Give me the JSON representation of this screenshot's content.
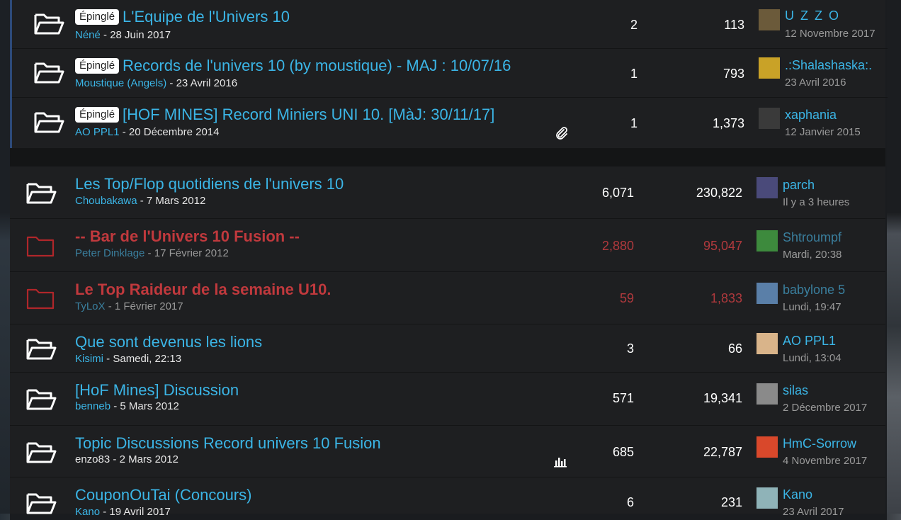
{
  "pinned_badge": "Épinglé",
  "pinned_topics": [
    {
      "title": "L'Equipe de l'Univers 10",
      "author": "Néné",
      "date": "28 Juin 2017",
      "replies": "2",
      "views": "113",
      "last_user": "U Z Z O",
      "last_date": "12 Novembre 2017",
      "avatar_color": "#6b5a3a"
    },
    {
      "title": "Records de l'univers 10 (by moustique) - MAJ : 10/07/16",
      "author": "Moustique (Angels)",
      "date": "23 Avril 2016",
      "replies": "1",
      "views": "793",
      "last_user": ".:Shalashaska:.",
      "last_date": "23 Avril 2016",
      "avatar_color": "#c9a227"
    },
    {
      "title": "[HOF MINES] Record Miniers UNI 10. [MàJ: 30/11/17]",
      "author": "AO PPL1",
      "date": "20 Décembre 2014",
      "replies": "1",
      "views": "1,373",
      "last_user": "xaphania",
      "last_date": "12 Janvier 2015",
      "avatar_color": "#3a3a3a",
      "attachment_icon": "paperclip-icon"
    }
  ],
  "topics": [
    {
      "title": "Les Top/Flop quotidiens de l'univers 10",
      "author": "Choubakawa",
      "date": "7 Mars 2012",
      "replies": "6,071",
      "views": "230,822",
      "last_user": "parch",
      "last_date": "Il y a 3 heures",
      "locked": false,
      "avatar_color": "#4a4a7a"
    },
    {
      "title": "-- Bar de l'Univers 10 Fusion --",
      "author": "Peter Dinklage",
      "date": "17 Février 2012",
      "replies": "2,880",
      "views": "95,047",
      "last_user": "Shtroumpf",
      "last_date": "Mardi, 20:38",
      "locked": true,
      "avatar_color": "#3d8a3d"
    },
    {
      "title": "Le Top Raideur de la semaine U10.",
      "author": "TyLoX",
      "date": "1 Février 2017",
      "replies": "59",
      "views": "1,833",
      "last_user": "babylone 5",
      "last_date": "Lundi, 19:47",
      "locked": true,
      "avatar_color": "#5a7fa8"
    },
    {
      "title": "Que sont devenus les lions",
      "author": "Kisimi",
      "date": "Samedi, 22:13",
      "replies": "3",
      "views": "66",
      "last_user": "AO PPL1",
      "last_date": "Lundi, 13:04",
      "locked": false,
      "avatar_color": "#d9b48a"
    },
    {
      "title": "[HoF Mines] Discussion",
      "author": "benneb",
      "date": "5 Mars 2012",
      "replies": "571",
      "views": "19,341",
      "last_user": "silas",
      "last_date": "2 Décembre 2017",
      "locked": false,
      "avatar_color": "#8a8a8a"
    },
    {
      "title": "Topic Discussions Record univers 10 Fusion",
      "author": "enzo83",
      "date": "2 Mars 2012",
      "replies": "685",
      "views": "22,787",
      "last_user": "HmC-Sorrow",
      "last_date": "4 Novembre 2017",
      "locked": false,
      "avatar_color": "#d9482b",
      "poll_icon": "poll-icon"
    },
    {
      "title": "CouponOuTai (Concours)",
      "author": "Kano",
      "date": "19 Avril 2017",
      "replies": "6",
      "views": "231",
      "last_user": "Kano",
      "last_date": "23 Avril 2017",
      "locked": false,
      "avatar_color": "#8fb3b8"
    }
  ]
}
